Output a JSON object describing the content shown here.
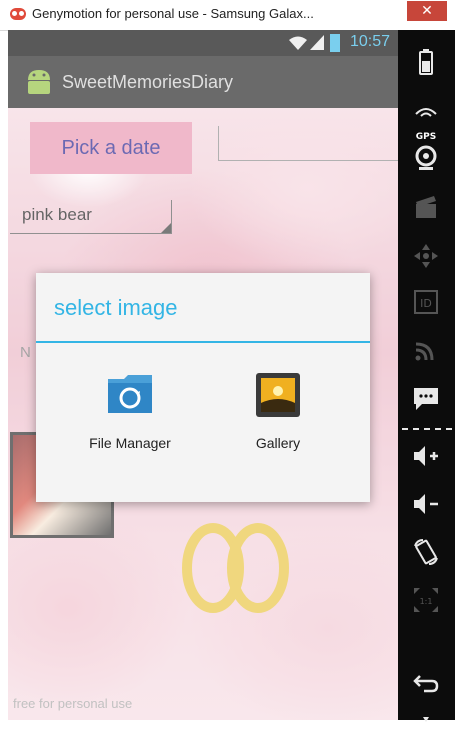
{
  "window": {
    "title": "Genymotion for personal use - Samsung Galax...",
    "close_label": "✕"
  },
  "status_bar": {
    "time": "10:57"
  },
  "action_bar": {
    "app_title": "SweetMemoriesDiary"
  },
  "form": {
    "pick_date_label": "Pick a date",
    "title_value": "pink bear",
    "name_partial": "N"
  },
  "dialog": {
    "title": "select image",
    "options": [
      {
        "label": "File Manager",
        "icon": "folder-sync-icon"
      },
      {
        "label": "Gallery",
        "icon": "gallery-icon"
      }
    ]
  },
  "sidebar": {
    "gps_label": "GPS",
    "id_label": "ID",
    "scale_label": "1:1"
  },
  "watermark": "free for personal use",
  "colors": {
    "accent": "#33b5e5",
    "button_bg": "#e992ae",
    "button_text": "#1c1a8a",
    "close": "#c7463a"
  }
}
